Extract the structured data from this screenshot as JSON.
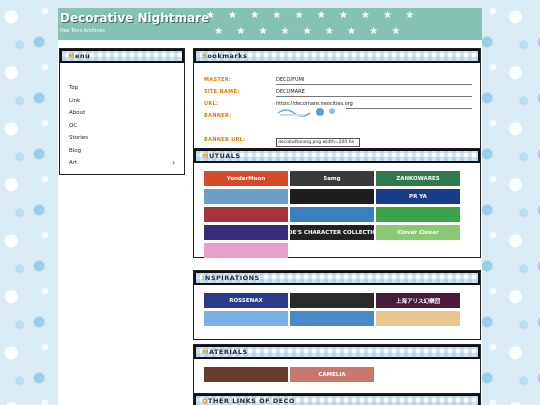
{
  "site": {
    "title": "Decorative Nightmare",
    "subtitle": "Has Tons Archives"
  },
  "menu": {
    "heading": "Menu",
    "items": [
      {
        "label": "Top",
        "arrow": ""
      },
      {
        "label": "Link",
        "arrow": ""
      },
      {
        "label": "About",
        "arrow": ""
      },
      {
        "label": "OC",
        "arrow": ""
      },
      {
        "label": "Stories",
        "arrow": ""
      },
      {
        "label": "Blog",
        "arrow": ""
      },
      {
        "label": "Art",
        "arrow": "›"
      }
    ]
  },
  "bookmarks": {
    "heading": "Bookmarks",
    "master_label": "MASTER:",
    "master_value": "DECO/FUMI",
    "site_label": "SITE NAME:",
    "site_value": "DECOMARE",
    "url_label": "URL:",
    "url_value": "https://decomare.neocities.org",
    "banner_label": "BANNER:",
    "banner_url_label": "BANNER URL:",
    "banner_url_value": "decobuttonorg.png width=200 he"
  },
  "mutuals": {
    "heading": "MUTUALS",
    "buttons": [
      {
        "text": "YonderMoon",
        "color": "#d64a2a"
      },
      {
        "text": "5amg",
        "color": "#3a3a3a"
      },
      {
        "text": "ZANKOWARES",
        "color": "#2f7a4a"
      },
      {
        "text": "",
        "color": "#6aa0c8"
      },
      {
        "text": "",
        "color": "#1e1e1e"
      },
      {
        "text": "PR YA",
        "color": "#1a3d8a"
      },
      {
        "text": "",
        "color": "#a8343a"
      },
      {
        "text": "",
        "color": "#3a7fbf"
      },
      {
        "text": "",
        "color": "#3aa34a"
      },
      {
        "text": "",
        "color": "#3a2a7a"
      },
      {
        "text": "MOE'S CHARACTER COLLECTION",
        "color": "#222222"
      },
      {
        "text": "Clover Clover",
        "color": "#8bc873"
      },
      {
        "text": "",
        "color": "#e8a0c8"
      }
    ]
  },
  "inspirations": {
    "heading": "INSPIRATIONS",
    "buttons": [
      {
        "text": "ROSSENAX",
        "color": "#2a3a8a"
      },
      {
        "text": "",
        "color": "#2a2a2a"
      },
      {
        "text": "上海アリス幻樂団",
        "color": "#4a1a3a"
      },
      {
        "text": "",
        "color": "#7ab0e8"
      },
      {
        "text": "",
        "color": "#4a8ac8"
      },
      {
        "text": "",
        "color": "#e8c890"
      }
    ]
  },
  "materials": {
    "heading": "MATERIALS",
    "buttons": [
      {
        "text": "",
        "color": "#6a3a2a"
      },
      {
        "text": "CAMELIA",
        "color": "#c8786a"
      }
    ]
  },
  "other": {
    "heading": "OTHER LINKS OF DECO"
  }
}
